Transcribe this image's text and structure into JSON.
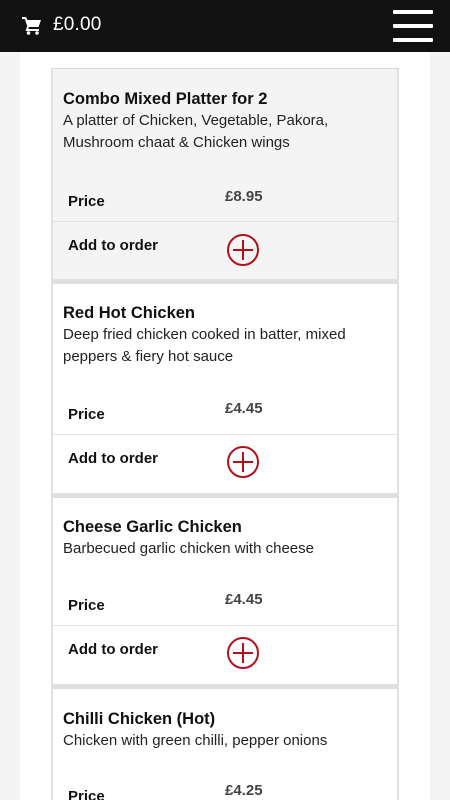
{
  "header": {
    "cart_total": "£0.00",
    "cart_icon": "shopping-cart-icon",
    "menu_icon": "hamburger-menu-icon"
  },
  "labels": {
    "price": "Price",
    "add_to_order": "Add to order"
  },
  "items": [
    {
      "name": "Combo Mixed Platter for 2",
      "description": "A platter of Chicken, Vegetable, Pakora, Mushroom chaat & Chicken wings",
      "price": "£8.95"
    },
    {
      "name": "Red Hot Chicken",
      "description": "Deep fried chicken cooked in batter, mixed peppers & fiery hot sauce",
      "price": "£4.45"
    },
    {
      "name": "Cheese Garlic Chicken",
      "description": "Barbecued garlic chicken with cheese",
      "price": "£4.45"
    },
    {
      "name": "Chilli Chicken (Hot)",
      "description": "Chicken with green chilli, pepper onions",
      "price": "£4.25"
    }
  ],
  "colors": {
    "header_bg": "#111111",
    "accent": "#b3101b"
  }
}
